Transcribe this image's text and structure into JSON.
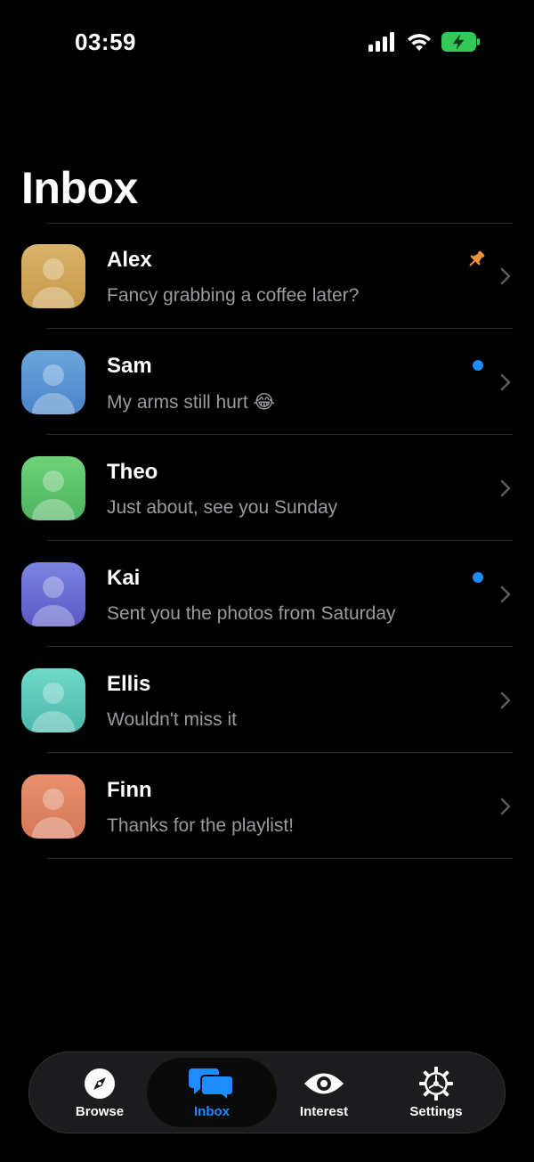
{
  "status": {
    "time": "03:59"
  },
  "page": {
    "title": "Inbox"
  },
  "conversations": [
    {
      "name": "Alex",
      "preview": "Fancy grabbing a coffee later?",
      "color_top": "#d9b46a",
      "color_bottom": "#c89a4a",
      "badge": "pin"
    },
    {
      "name": "Sam",
      "preview": "My arms still hurt 😂",
      "color_top": "#6aa6dc",
      "color_bottom": "#4b83c8",
      "badge": "unread"
    },
    {
      "name": "Theo",
      "preview": "Just about, see you Sunday",
      "color_top": "#6fd27a",
      "color_bottom": "#4cb35e",
      "badge": "none"
    },
    {
      "name": "Kai",
      "preview": "Sent you the photos from Saturday",
      "color_top": "#7b85e2",
      "color_bottom": "#5a58c4",
      "badge": "unread"
    },
    {
      "name": "Ellis",
      "preview": "Wouldn't miss it",
      "color_top": "#6fd9c9",
      "color_bottom": "#4cb8ad",
      "badge": "none"
    },
    {
      "name": "Finn",
      "preview": "Thanks for the playlist!",
      "color_top": "#e8906e",
      "color_bottom": "#d67858",
      "badge": "none"
    }
  ],
  "tabs": [
    {
      "label": "Browse",
      "icon": "compass-icon",
      "active": false
    },
    {
      "label": "Inbox",
      "icon": "chat-bubbles-icon",
      "active": true
    },
    {
      "label": "Interest",
      "icon": "eye-icon",
      "active": false
    },
    {
      "label": "Settings",
      "icon": "gear-icon",
      "active": false
    }
  ],
  "colors": {
    "accent": "#1e8bff",
    "pin": "#f0923a",
    "battery": "#34c759"
  }
}
